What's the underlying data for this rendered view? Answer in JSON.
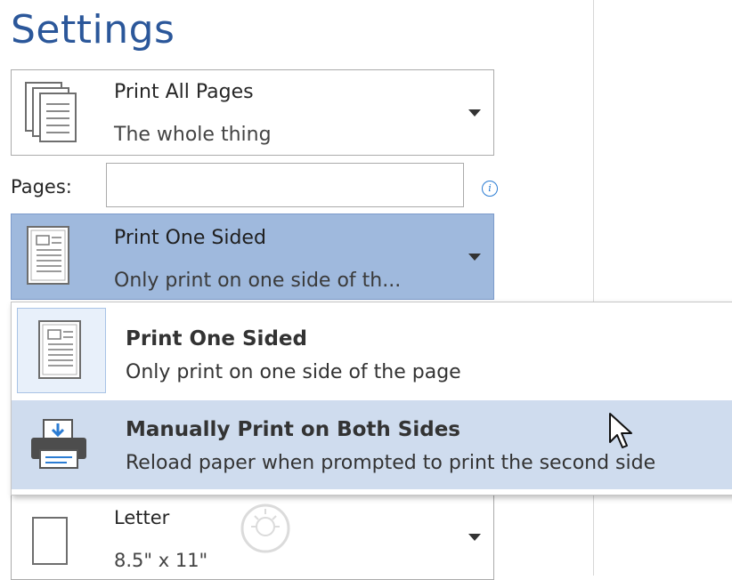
{
  "settings": {
    "title": "Settings"
  },
  "print_range": {
    "title": "Print All Pages",
    "subtitle": "The whole thing",
    "icon": "pages-stack-icon"
  },
  "pages": {
    "label": "Pages:",
    "value": "",
    "info_icon": "info-icon"
  },
  "sides": {
    "title": "Print One Sided",
    "subtitle": "Only print on one side of th...",
    "icon": "one-sided-page-icon",
    "menu": [
      {
        "title": "Print One Sided",
        "desc": "Only print on one side of the page",
        "icon": "one-sided-page-icon"
      },
      {
        "title": "Manually Print on Both Sides",
        "desc": "Reload paper when prompted to print the second side",
        "icon": "printer-icon"
      }
    ]
  },
  "paper": {
    "title": "Letter",
    "subtitle": "8.5\" x 11\"",
    "icon": "blank-page-icon"
  },
  "colors": {
    "accent": "#2b579a",
    "selected_bg": "#9fb9dd",
    "hover_bg": "#cfdcee"
  }
}
